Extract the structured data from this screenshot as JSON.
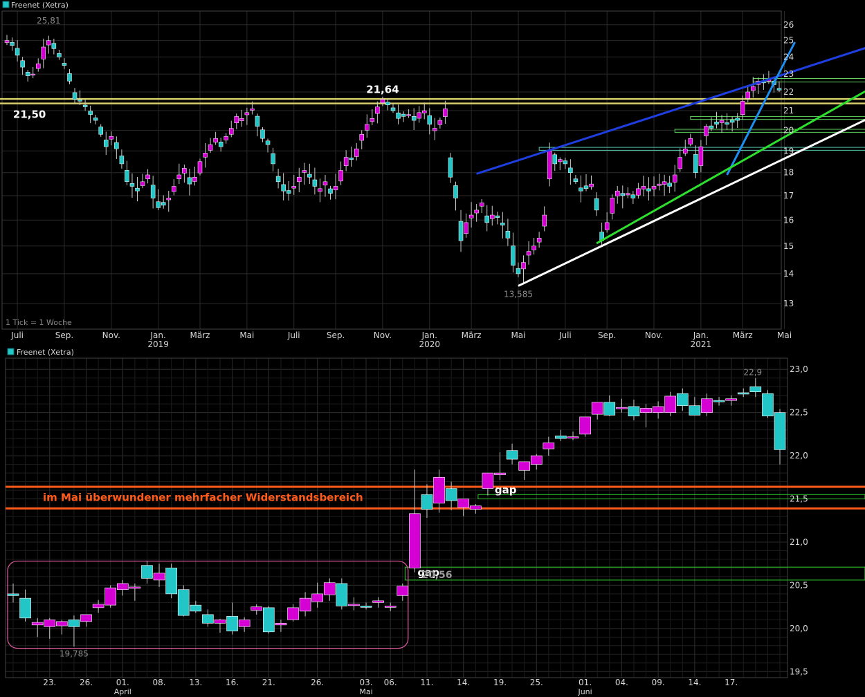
{
  "colors": {
    "background": "#000000",
    "grid": "#2a2a2a",
    "up": "#d400d4",
    "down": "#22c6c6",
    "wick": "#cccccc",
    "text": "#d8d8d8",
    "dim_text": "#8a8a8a",
    "resistance_yellow": "#d6cf6a",
    "trend_blue": "#1f3ee0",
    "trend_lightblue": "#1e8ef0",
    "trend_green": "#2ee02e",
    "trend_white": "#ffffff",
    "zone_green": "#5fd45f",
    "zone_teal": "#55c8b0",
    "orange": "#ff5a1a",
    "box_pink": "#e05aa0",
    "gap_green": "#2fcf2f"
  },
  "chart_data": [
    {
      "type": "candlestick",
      "title": "Freenet (Xetra)",
      "note": "1 Tick = 1 Woche",
      "ylim": [
        12.2,
        26.9
      ],
      "y_scale": "log",
      "yticks": [
        13,
        14,
        15,
        16,
        17,
        18,
        19,
        20,
        21,
        22,
        23,
        24,
        25,
        26
      ],
      "x_months": [
        "Juli",
        "Sep.",
        "Nov.",
        "Jan.",
        "März",
        "Mai",
        "Juli",
        "Sep.",
        "Nov.",
        "Jan.",
        "März",
        "Mai",
        "Juli",
        "Sep.",
        "Nov.",
        "Jan.",
        "März",
        "Mai"
      ],
      "x_month_index": [
        2,
        11,
        20,
        29,
        37,
        46,
        55,
        63,
        72,
        81,
        89,
        98,
        107,
        115,
        124,
        133,
        141,
        149
      ],
      "x_years": [
        {
          "label": "2019",
          "index": 29
        },
        {
          "label": "2020",
          "index": 81
        },
        {
          "label": "2021",
          "index": 133
        }
      ],
      "closes": [
        25.0,
        24.7,
        24.1,
        23.4,
        22.9,
        23.0,
        23.6,
        24.6,
        25.0,
        24.5,
        24.0,
        23.5,
        22.6,
        21.6,
        21.5,
        21.2,
        20.8,
        20.5,
        19.8,
        19.2,
        19.7,
        19.1,
        18.4,
        17.6,
        17.4,
        17.2,
        17.6,
        17.9,
        16.9,
        16.5,
        16.6,
        16.9,
        17.4,
        17.9,
        18.2,
        17.5,
        17.8,
        18.5,
        18.9,
        19.3,
        19.6,
        19.2,
        19.7,
        20.1,
        20.7,
        20.6,
        20.9,
        21.1,
        20.2,
        19.6,
        19.3,
        18.4,
        17.6,
        17.2,
        17.1,
        17.4,
        17.8,
        18.1,
        17.8,
        17.4,
        17.3,
        17.6,
        17.1,
        17.4,
        18.1,
        18.7,
        18.6,
        19.1,
        19.8,
        20.3,
        20.6,
        21.2,
        21.6,
        21.3,
        21.0,
        20.6,
        20.7,
        20.8,
        20.5,
        20.9,
        21.0,
        20.3,
        20.1,
        20.5,
        21.1,
        17.8,
        16.9,
        15.2,
        15.9,
        16.2,
        16.4,
        16.7,
        15.9,
        16.2,
        16.1,
        15.8,
        15.3,
        14.3,
        14.0,
        14.4,
        14.8,
        15.0,
        15.3,
        16.2,
        19.0,
        18.4,
        18.6,
        18.4,
        18.0,
        17.6,
        17.2,
        17.3,
        17.5,
        16.4,
        15.2,
        15.9,
        16.9,
        17.2,
        17.0,
        17.1,
        16.9,
        17.3,
        17.4,
        17.2,
        17.4,
        17.5,
        17.6,
        17.4,
        17.9,
        18.7,
        19.1,
        19.6,
        18.0,
        19.2,
        20.2,
        20.1,
        20.3,
        20.5,
        20.3,
        20.4,
        20.5,
        21.5,
        22.0,
        22.3,
        22.6,
        22.5,
        22.7,
        22.4,
        22.1
      ],
      "series": [
        {
          "name": "Freenet (Xetra)"
        }
      ],
      "labels": [
        {
          "text": "25,81",
          "index": 8
        },
        {
          "text": "21,50",
          "index": 3
        },
        {
          "text": "21,64",
          "index": 72
        },
        {
          "text": "13,585",
          "index": 98
        }
      ],
      "resistance_levels": [
        21.38,
        21.62
      ],
      "zones": [
        {
          "color": "teal",
          "lower": 19.03,
          "upper": 19.17,
          "from_index": 102
        },
        {
          "color": "green",
          "lower": 19.9,
          "upper": 20.05,
          "from_index": 128
        },
        {
          "color": "green",
          "lower": 20.55,
          "upper": 20.7,
          "from_index": 131
        },
        {
          "color": "green",
          "lower": 22.55,
          "upper": 22.75,
          "from_index": 143
        }
      ],
      "trendlines": [
        {
          "color": "blue",
          "from": {
            "index": 90,
            "value": 17.95
          },
          "to": {
            "index": 168,
            "value": 24.9
          }
        },
        {
          "color": "lightblue",
          "from": {
            "index": 138,
            "value": 17.9
          },
          "to": {
            "index": 151,
            "value": 24.9
          }
        },
        {
          "color": "green",
          "from": {
            "index": 113,
            "value": 15.1
          },
          "to": {
            "index": 175,
            "value": 23.8
          }
        },
        {
          "color": "white",
          "from": {
            "index": 98,
            "value": 13.585
          },
          "to": {
            "index": 172,
            "value": 21.5
          }
        }
      ]
    },
    {
      "type": "candlestick",
      "title": "Freenet (Xetra)",
      "ylim": [
        19.43,
        23.13
      ],
      "yticks": [
        19.5,
        20.0,
        20.5,
        21.0,
        21.5,
        22.0,
        22.5,
        23.0
      ],
      "ytick_labels": [
        "19,5",
        "20,0",
        "20,5",
        "21,0",
        "21,5",
        "22,0",
        "22,5",
        "23,0"
      ],
      "x_days": [
        "23.",
        "26.",
        "01.",
        "08.",
        "13.",
        "16.",
        "21.",
        "26.",
        "03.",
        "06.",
        "11.",
        "14.",
        "19.",
        "25.",
        "01.",
        "04.",
        "09.",
        "14.",
        "17."
      ],
      "x_day_index": [
        3,
        6,
        9,
        12,
        15,
        18,
        21,
        25,
        29,
        31,
        34,
        37,
        40,
        43,
        47,
        50,
        53,
        56,
        59
      ],
      "x_months": [
        {
          "label": "April",
          "index": 9
        },
        {
          "label": "Mai",
          "index": 29
        },
        {
          "label": "Juni",
          "index": 47
        }
      ],
      "candles": [
        {
          "open": 20.4,
          "high": 20.52,
          "low": 20.3,
          "close": 20.38
        },
        {
          "open": 20.35,
          "high": 20.45,
          "low": 20.08,
          "close": 20.12
        },
        {
          "open": 20.04,
          "high": 20.12,
          "low": 19.9,
          "close": 20.07
        },
        {
          "open": 20.02,
          "high": 20.12,
          "low": 19.88,
          "close": 20.1
        },
        {
          "open": 20.03,
          "high": 20.1,
          "low": 19.93,
          "close": 20.08
        },
        {
          "open": 20.1,
          "high": 20.15,
          "low": 19.79,
          "close": 20.02
        },
        {
          "open": 20.08,
          "high": 20.16,
          "low": 20.02,
          "close": 20.16
        },
        {
          "open": 20.24,
          "high": 20.33,
          "low": 20.18,
          "close": 20.28
        },
        {
          "open": 20.27,
          "high": 20.5,
          "low": 20.24,
          "close": 20.47
        },
        {
          "open": 20.45,
          "high": 20.56,
          "low": 20.38,
          "close": 20.52
        },
        {
          "open": 20.48,
          "high": 20.52,
          "low": 20.32,
          "close": 20.48
        },
        {
          "open": 20.73,
          "high": 20.78,
          "low": 20.52,
          "close": 20.58
        },
        {
          "open": 20.56,
          "high": 20.75,
          "low": 20.48,
          "close": 20.64
        },
        {
          "open": 20.7,
          "high": 20.75,
          "low": 20.35,
          "close": 20.4
        },
        {
          "open": 20.45,
          "high": 20.5,
          "low": 20.14,
          "close": 20.15
        },
        {
          "open": 20.27,
          "high": 20.32,
          "low": 20.18,
          "close": 20.2
        },
        {
          "open": 20.16,
          "high": 20.22,
          "low": 20.02,
          "close": 20.06
        },
        {
          "open": 20.06,
          "high": 20.11,
          "low": 19.95,
          "close": 20.1
        },
        {
          "open": 20.14,
          "high": 20.3,
          "low": 19.93,
          "close": 19.97
        },
        {
          "open": 20.02,
          "high": 20.13,
          "low": 19.96,
          "close": 20.1
        },
        {
          "open": 20.21,
          "high": 20.28,
          "low": 20.16,
          "close": 20.25
        },
        {
          "open": 20.24,
          "high": 20.26,
          "low": 19.94,
          "close": 19.96
        },
        {
          "open": 20.04,
          "high": 20.1,
          "low": 19.96,
          "close": 20.06
        },
        {
          "open": 20.1,
          "high": 20.28,
          "low": 20.08,
          "close": 20.24
        },
        {
          "open": 20.2,
          "high": 20.42,
          "low": 20.14,
          "close": 20.35
        },
        {
          "open": 20.31,
          "high": 20.53,
          "low": 20.24,
          "close": 20.4
        },
        {
          "open": 20.39,
          "high": 20.58,
          "low": 20.32,
          "close": 20.53
        },
        {
          "open": 20.52,
          "high": 20.58,
          "low": 20.22,
          "close": 20.26
        },
        {
          "open": 20.28,
          "high": 20.36,
          "low": 20.21,
          "close": 20.28
        },
        {
          "open": 20.26,
          "high": 20.3,
          "low": 20.22,
          "close": 20.25
        },
        {
          "open": 20.3,
          "high": 20.36,
          "low": 20.24,
          "close": 20.32
        },
        {
          "open": 20.25,
          "high": 20.3,
          "low": 20.2,
          "close": 20.26
        },
        {
          "open": 20.38,
          "high": 20.52,
          "low": 20.32,
          "close": 20.49
        },
        {
          "open": 20.7,
          "high": 21.84,
          "low": 20.65,
          "close": 21.33
        },
        {
          "open": 21.55,
          "high": 21.67,
          "low": 21.28,
          "close": 21.38
        },
        {
          "open": 21.45,
          "high": 21.84,
          "low": 21.34,
          "close": 21.75
        },
        {
          "open": 21.62,
          "high": 21.7,
          "low": 21.37,
          "close": 21.48
        },
        {
          "open": 21.4,
          "high": 21.48,
          "low": 21.3,
          "close": 21.5
        },
        {
          "open": 21.38,
          "high": 21.44,
          "low": 21.33,
          "close": 21.42
        },
        {
          "open": 21.62,
          "high": 21.8,
          "low": 21.54,
          "close": 21.8
        },
        {
          "open": 21.78,
          "high": 22.04,
          "low": 21.72,
          "close": 21.8
        },
        {
          "open": 22.06,
          "high": 22.14,
          "low": 21.9,
          "close": 21.96
        },
        {
          "open": 21.83,
          "high": 21.92,
          "low": 21.72,
          "close": 21.93
        },
        {
          "open": 21.9,
          "high": 22.02,
          "low": 21.84,
          "close": 22.0
        },
        {
          "open": 22.08,
          "high": 22.22,
          "low": 22.0,
          "close": 22.15
        },
        {
          "open": 22.23,
          "high": 22.3,
          "low": 22.17,
          "close": 22.2
        },
        {
          "open": 22.22,
          "high": 22.28,
          "low": 22.18,
          "close": 22.22
        },
        {
          "open": 22.25,
          "high": 22.45,
          "low": 22.22,
          "close": 22.45
        },
        {
          "open": 22.48,
          "high": 22.6,
          "low": 22.42,
          "close": 22.62
        },
        {
          "open": 22.62,
          "high": 22.7,
          "low": 22.46,
          "close": 22.47
        },
        {
          "open": 22.56,
          "high": 22.66,
          "low": 22.5,
          "close": 22.56
        },
        {
          "open": 22.57,
          "high": 22.65,
          "low": 22.41,
          "close": 22.46
        },
        {
          "open": 22.5,
          "high": 22.6,
          "low": 22.33,
          "close": 22.55
        },
        {
          "open": 22.5,
          "high": 22.63,
          "low": 22.43,
          "close": 22.57
        },
        {
          "open": 22.5,
          "high": 22.74,
          "low": 22.46,
          "close": 22.69
        },
        {
          "open": 22.72,
          "high": 22.78,
          "low": 22.52,
          "close": 22.58
        },
        {
          "open": 22.58,
          "high": 22.68,
          "low": 22.47,
          "close": 22.47
        },
        {
          "open": 22.5,
          "high": 22.72,
          "low": 22.46,
          "close": 22.66
        },
        {
          "open": 22.64,
          "high": 22.68,
          "low": 22.58,
          "close": 22.63
        },
        {
          "open": 22.64,
          "high": 22.7,
          "low": 22.58,
          "close": 22.66
        },
        {
          "open": 22.73,
          "high": 22.78,
          "low": 22.68,
          "close": 22.72
        },
        {
          "open": 22.8,
          "high": 22.9,
          "low": 22.68,
          "close": 22.74
        },
        {
          "open": 22.72,
          "high": 22.76,
          "low": 22.44,
          "close": 22.46
        },
        {
          "open": 22.5,
          "high": 22.54,
          "low": 21.9,
          "close": 22.07
        }
      ],
      "labels": [
        {
          "text": "22,9",
          "index": 61
        },
        {
          "text": "19,785",
          "index": 5
        },
        {
          "text": "20,56",
          "index": 33
        }
      ],
      "resistance_zone": {
        "lower": 21.39,
        "upper": 21.64,
        "text": "im Mai überwundener mehrfacher Widerstandsbereich"
      },
      "gaps": [
        {
          "text": "gap",
          "lower": 20.56,
          "upper": 20.71,
          "from_index": 33
        },
        {
          "text": "gap",
          "lower": 21.5,
          "upper": 21.55,
          "from_index": 39
        }
      ],
      "consolidation_box": {
        "from_index": 0,
        "to_index": 32,
        "lower": 19.77,
        "upper": 20.78
      }
    }
  ]
}
